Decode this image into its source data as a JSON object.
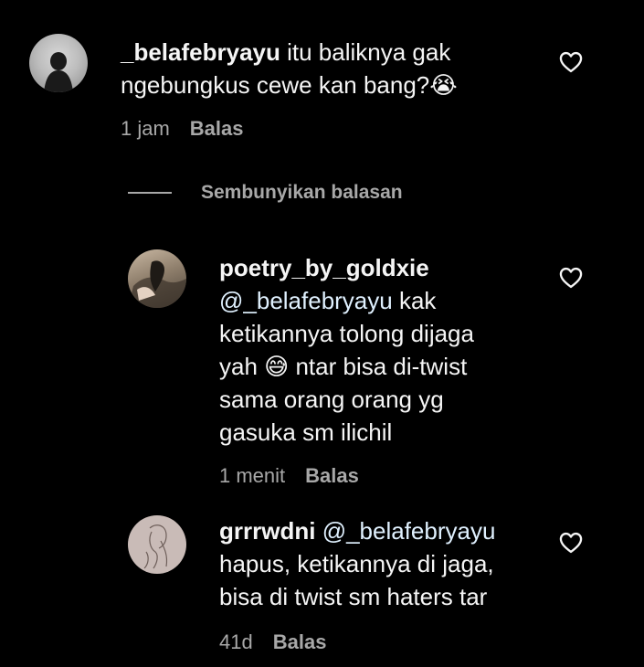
{
  "comments": [
    {
      "username": "_belafebryayu",
      "line1": " itu baliknya gak",
      "line2": "ngebungkus cewe kan bang?😭",
      "time": "1 jam",
      "reply_label": "Balas"
    }
  ],
  "hide_replies_label": "Sembunyikan balasan",
  "replies": [
    {
      "username": "poetry_by_goldxie",
      "mention": "@_belafebryayu",
      "line1_rest": " kak",
      "line2": "ketikannya tolong dijaga",
      "line3": "yah 😅 ntar bisa di-twist",
      "line4": "sama orang orang yg",
      "line5": "gasuka sm ilichil",
      "time": "1 menit",
      "reply_label": "Balas"
    },
    {
      "username": "grrrwdni",
      "mention": "@_belafebryayu",
      "line2": "hapus, ketikannya di jaga,",
      "line3": "bisa di twist sm haters tar",
      "time": "41d",
      "reply_label": "Balas"
    }
  ],
  "colors": {
    "background": "#000000",
    "text": "#f5f5f5",
    "secondary": "#a8a8a8",
    "mention": "#e0f1ff"
  },
  "icons": {
    "like": "heart-outline-icon"
  }
}
